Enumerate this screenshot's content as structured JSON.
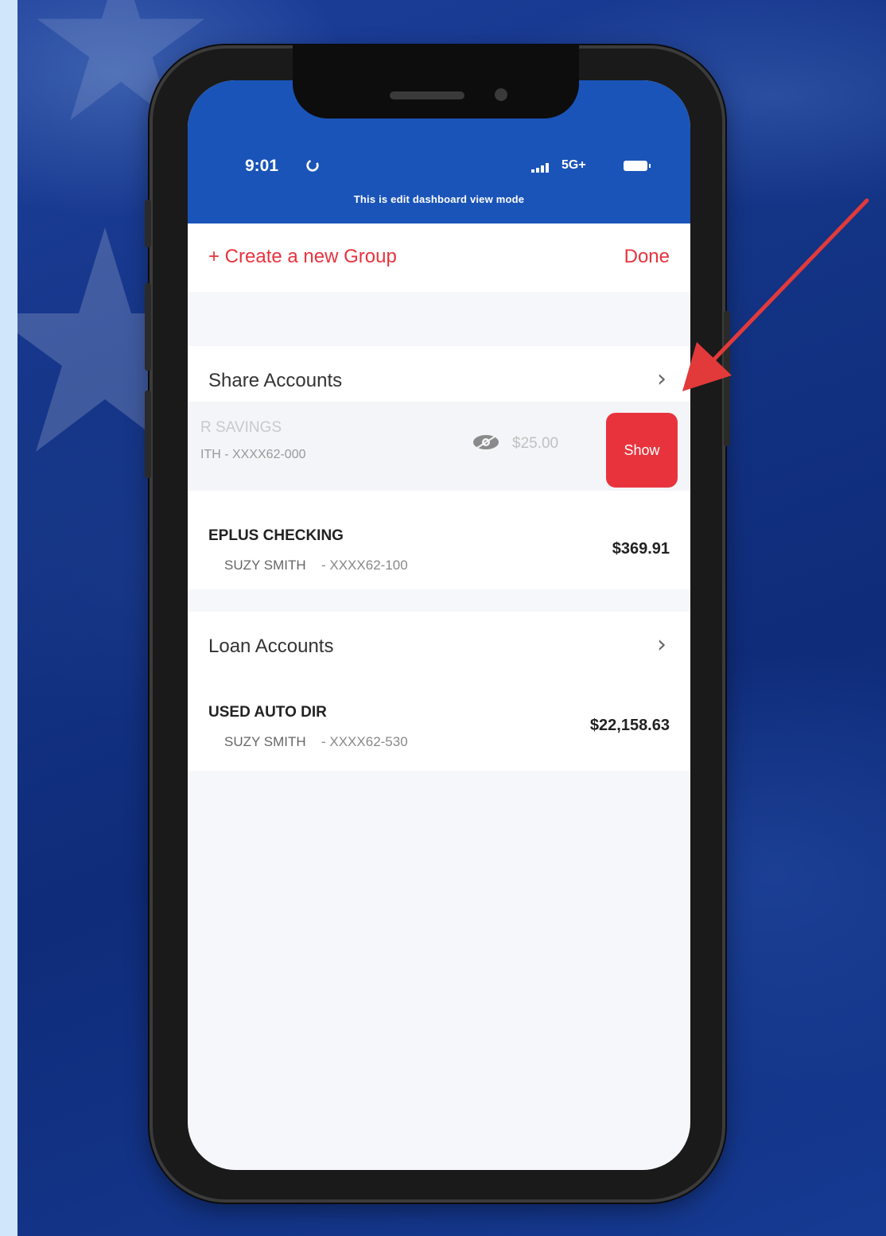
{
  "status_bar": {
    "time": "9:01",
    "network": "5G+",
    "colors": {
      "bar": "#1a54b8"
    }
  },
  "banner": {
    "text": "This is edit dashboard view mode"
  },
  "toolbar": {
    "create_group_label": "+ Create a new Group",
    "done_label": "Done"
  },
  "share_accounts": {
    "title": "Share Accounts",
    "swiped_account": {
      "name": "R SAVINGS",
      "owner_number": "ITH - XXXX62-000",
      "balance": "$25.00",
      "show_label": "Show"
    },
    "accounts": [
      {
        "name": "EPLUS CHECKING",
        "owner": "SUZY SMITH",
        "number": "- XXXX62-100",
        "balance": "$369.91"
      }
    ]
  },
  "loan_accounts": {
    "title": "Loan Accounts",
    "accounts": [
      {
        "name": "USED AUTO DIR",
        "owner": "SUZY SMITH",
        "number": "- XXXX62-530",
        "balance": "$22,158.63"
      }
    ]
  },
  "theme": {
    "accent": "#e8333d",
    "brand_blue": "#1a54b8"
  }
}
